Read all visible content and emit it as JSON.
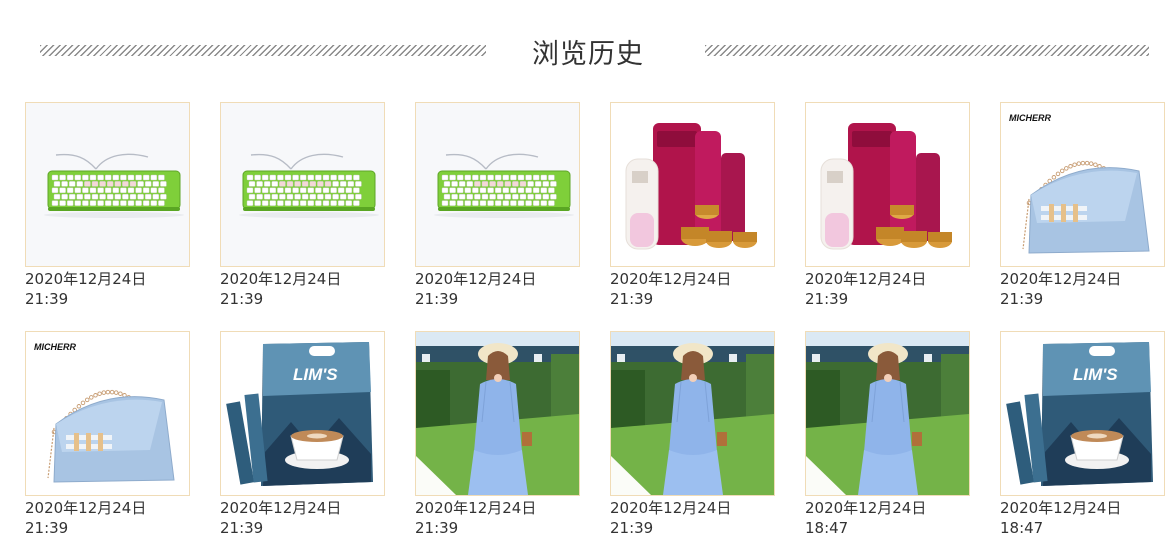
{
  "page": {
    "title": "浏览历史"
  },
  "items": [
    {
      "image": "keyboard-image",
      "date": "2020年12月24日",
      "time": "21:39"
    },
    {
      "image": "keyboard-image",
      "date": "2020年12月24日",
      "time": "21:39"
    },
    {
      "image": "keyboard-image",
      "date": "2020年12月24日",
      "time": "21:39"
    },
    {
      "image": "cosmetics-set-image",
      "date": "2020年12月24日",
      "time": "21:39"
    },
    {
      "image": "cosmetics-set-image",
      "date": "2020年12月24日",
      "time": "21:39"
    },
    {
      "image": "handbag-image",
      "logo": "MICHERR",
      "date": "2020年12月24日",
      "time": "21:39"
    },
    {
      "image": "handbag-image",
      "logo": "MICHERR",
      "date": "2020年12月24日",
      "time": "21:39"
    },
    {
      "image": "coffee-package-image",
      "brand": "LIM'S",
      "date": "2020年12月24日",
      "time": "21:39"
    },
    {
      "image": "dress-model-image",
      "date": "2020年12月24日",
      "time": "21:39"
    },
    {
      "image": "dress-model-image",
      "date": "2020年12月24日",
      "time": "21:39"
    },
    {
      "image": "dress-model-image",
      "date": "2020年12月24日",
      "time": "18:47"
    },
    {
      "image": "coffee-package-image",
      "brand": "LIM'S",
      "date": "2020年12月24日",
      "time": "18:47"
    }
  ]
}
